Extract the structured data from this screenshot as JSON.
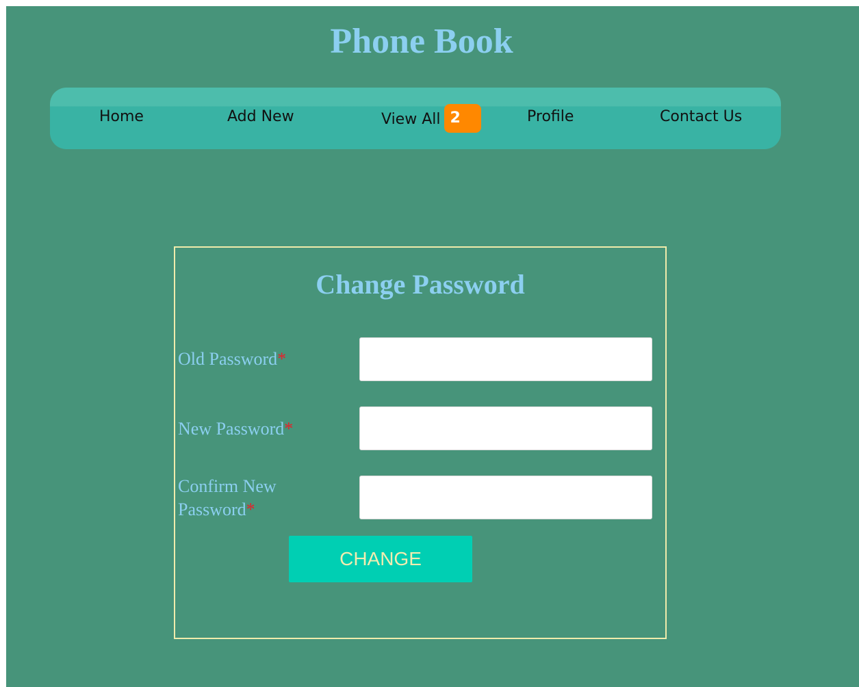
{
  "header": {
    "title": "Phone Book"
  },
  "nav": {
    "items": [
      {
        "label": "Home"
      },
      {
        "label": "Add New"
      },
      {
        "label": "View All",
        "badge": "2"
      },
      {
        "label": "Profile"
      },
      {
        "label": "Contact Us"
      }
    ]
  },
  "form": {
    "title": "Change Password",
    "fields": [
      {
        "label": "Old Password",
        "required_mark": "*",
        "value": ""
      },
      {
        "label": "New Password",
        "required_mark": "*",
        "value": ""
      },
      {
        "label": "Confirm New Password",
        "required_mark": "*",
        "value": ""
      }
    ],
    "submit_label": "CHANGE"
  },
  "colors": {
    "page_background": "#47947a",
    "title_color": "#8ccff0",
    "nav_background": "#39b3a4",
    "badge_background": "#ff8800",
    "form_border": "#f0ecac",
    "button_background": "#00cfb3",
    "button_text": "#f2ecb0",
    "required_mark": "#e8202a"
  }
}
